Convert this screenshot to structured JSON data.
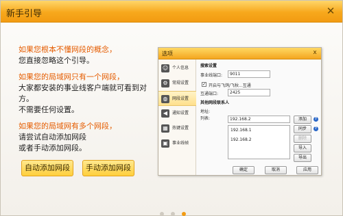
{
  "window": {
    "title": "新手引导",
    "close": "✕"
  },
  "guide": {
    "q1": "如果您根本不懂网段的概念，",
    "a1": "您直接忽略这个引导。",
    "q2": "如果您的局域网只有一个网段，",
    "a2a": "大家都安装的事业线客户端就可看到对方。",
    "a2b": "不需要任何设置。",
    "q3": "如果您的局域网有多个网段，",
    "a3a": "请尝试自动添加网段",
    "a3b": "或者手动添加网段。"
  },
  "buttons": {
    "auto": "自动添加网段",
    "manual": "手动添加网段"
  },
  "pager": {
    "count": 3,
    "active": 3
  },
  "colors": {
    "accent": "#f29b12",
    "highlight": "#e55c00"
  },
  "dialog": {
    "title": "选项",
    "close": "x",
    "sidebar": [
      {
        "label": "个人信息",
        "icon": "person-icon"
      },
      {
        "label": "常规设置",
        "icon": "settings-icon"
      },
      {
        "label": "网段设置",
        "icon": "globe-icon",
        "selected": true
      },
      {
        "label": "通知设置",
        "icon": "speaker-icon"
      },
      {
        "label": "热键设置",
        "icon": "keyboard-icon"
      },
      {
        "label": "事业线帧",
        "icon": "lock-icon"
      }
    ],
    "search_header": "搜索设置",
    "port_label": "事业线端口:",
    "port_value": "9011",
    "interop_label": "开启与飞鸽/飞秋...互通",
    "interop_checked": true,
    "interop_port_label": "互通端口:",
    "interop_port_value": "2425",
    "contacts_header": "其他网段联系人",
    "address_label": "地址:",
    "address_value": "192.168.2",
    "list_label": "列表:",
    "list_items": [
      "192.168.1",
      "192.168.2"
    ],
    "side_buttons": {
      "add": "添加",
      "sync": "同步",
      "delete": "删除",
      "import": "导入",
      "export": "导出"
    },
    "footer": {
      "ok": "确定",
      "cancel": "取消",
      "apply": "应用"
    }
  }
}
